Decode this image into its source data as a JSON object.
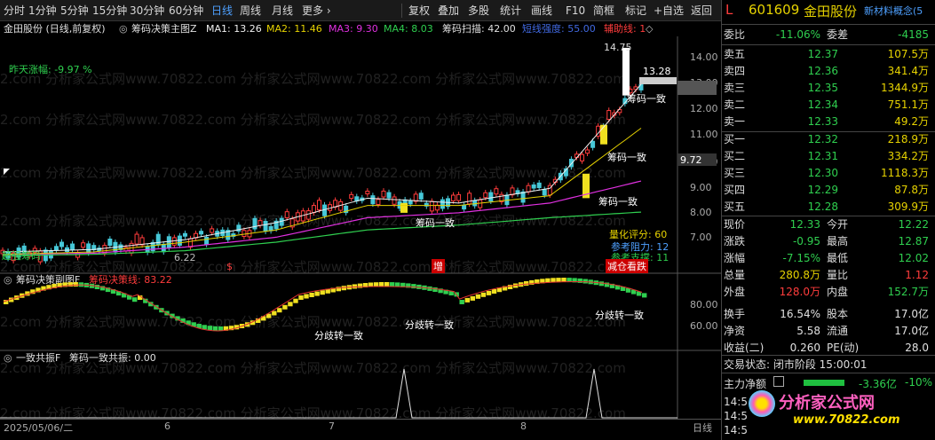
{
  "toolbar": {
    "items": [
      "分时",
      "1分钟",
      "5分钟",
      "15分钟",
      "30分钟",
      "60分钟",
      "日线",
      "周线",
      "月线",
      "更多 ›",
      "复权",
      "叠加",
      "多股",
      "统计",
      "画线",
      "F10",
      "简框",
      "标记",
      "+自选",
      "返回"
    ],
    "active": "日线"
  },
  "main_chart": {
    "title": "金田股份 (日线,前复权)",
    "indicator_name": "筹码决策主图Z",
    "ma1": "MA1: 13.26",
    "ma2": "MA2: 11.46",
    "ma3": "MA3: 9.30",
    "ma4": "MA4: 8.03",
    "scan": "筹码扫描: 42.00",
    "trend": "短线强度: 55.00",
    "aux": "辅助线: 1",
    "yesterday_change": "昨天涨幅: -9.97 %",
    "high_label": "14.75",
    "price_tag": "13.28",
    "cursor_tag": "9.72",
    "low_label": "6.22",
    "score_label": "量化评分: 60",
    "resist_label": "参考阻力: 12",
    "support_label": "参考支撑: 11",
    "signal1": "筹码一致",
    "signal2": "筹码一致",
    "signal3": "筹码一致",
    "signal4": "筹码一致",
    "left_tag": "超强筹码",
    "bottom_tag": "增",
    "red_tag": "$",
    "status_tag": "减仓看跌",
    "y_ticks": [
      "14.00",
      "13.00",
      "12.00",
      "11.00",
      "10.00",
      "9.00",
      "8.00",
      "7.00"
    ]
  },
  "sub_chart1": {
    "name": "筹码决策副图F",
    "value": "筹码决策线: 83.22",
    "label1": "分歧转一致",
    "label2": "分歧转一致",
    "label3": "分歧转一致",
    "y_ticks": [
      "80.00",
      "60.00"
    ]
  },
  "sub_chart2": {
    "name": "一致共振F",
    "value": "筹码一致共振: 0.00"
  },
  "x_axis": {
    "labels": [
      "2025/05/06/二",
      "6",
      "7",
      "8"
    ],
    "period": "日线"
  },
  "watermark": "2.com 分析家公式网www.70822.com 分析家公式网www.70822.com 分析家公式网www.70822.com",
  "quote": {
    "flag": "L",
    "code": "601609",
    "name": "金田股份",
    "concept": "新材料概念(5",
    "weibi_label": "委比",
    "weibi": "-11.06%",
    "weicha_label": "委差",
    "weicha": "-4185",
    "asks": [
      {
        "label": "卖五",
        "price": "12.37",
        "vol": "107.5万"
      },
      {
        "label": "卖四",
        "price": "12.36",
        "vol": "341.4万"
      },
      {
        "label": "卖三",
        "price": "12.35",
        "vol": "1344.9万"
      },
      {
        "label": "卖二",
        "price": "12.34",
        "vol": "751.1万"
      },
      {
        "label": "卖一",
        "price": "12.33",
        "vol": "49.2万"
      }
    ],
    "bids": [
      {
        "label": "买一",
        "price": "12.32",
        "vol": "218.9万"
      },
      {
        "label": "买二",
        "price": "12.31",
        "vol": "334.2万"
      },
      {
        "label": "买三",
        "price": "12.30",
        "vol": "1118.3万"
      },
      {
        "label": "买四",
        "price": "12.29",
        "vol": "87.8万"
      },
      {
        "label": "买五",
        "price": "12.28",
        "vol": "309.9万"
      }
    ],
    "stats": [
      {
        "l1": "现价",
        "v1": "12.33",
        "c1": "green",
        "l2": "今开",
        "v2": "12.22",
        "c2": "green"
      },
      {
        "l1": "涨跌",
        "v1": "-0.95",
        "c1": "green",
        "l2": "最高",
        "v2": "12.87",
        "c2": "green"
      },
      {
        "l1": "涨幅",
        "v1": "-7.15%",
        "c1": "green",
        "l2": "最低",
        "v2": "12.02",
        "c2": "green"
      },
      {
        "l1": "总量",
        "v1": "280.8万",
        "c1": "yellow",
        "l2": "量比",
        "v2": "1.12",
        "c2": "red"
      },
      {
        "l1": "外盘",
        "v1": "128.0万",
        "c1": "red",
        "l2": "内盘",
        "v2": "152.7万",
        "c2": "green"
      },
      {
        "l1": "换手",
        "v1": "16.54%",
        "c1": "white",
        "l2": "股本",
        "v2": "17.0亿",
        "c2": "white"
      },
      {
        "l1": "净资",
        "v1": "5.58",
        "c1": "white",
        "l2": "流通",
        "v2": "17.0亿",
        "c2": "white"
      },
      {
        "l1": "收益(二)",
        "v1": "0.260",
        "c1": "white",
        "l2": "PE(动)",
        "v2": "28.0",
        "c2": "white"
      }
    ],
    "trade_status": "交易状态: 闭市阶段 15:00:01",
    "main_flow_label": "主力净额",
    "main_flow_value": "-3.36亿",
    "main_flow_pct": "-10%",
    "times": [
      "14:5",
      "14:5",
      "14:5"
    ],
    "logo_text": "分析家公式网",
    "logo_url": "www.70822.com"
  },
  "colors": {
    "up": "#ff3c3c",
    "down": "#2fcf4f",
    "up_body": "#e63030",
    "down_body": "#46c8d8",
    "yellow_bar": "#f0e020",
    "accent_blue": "#4169e1"
  },
  "chart_data": {
    "type": "line",
    "title": "",
    "xlabel": "",
    "ylabel": "",
    "ylim": [
      6.0,
      15.0
    ],
    "note_series": "approximate daily close path",
    "x": [
      "2025/05/06",
      "6",
      "7",
      "8"
    ],
    "series": [
      {
        "name": "MA1",
        "values": [
          6.4,
          6.5,
          6.9,
          7.6,
          8.6,
          8.4,
          9.0,
          13.26
        ]
      },
      {
        "name": "MA2",
        "values": [
          6.3,
          6.4,
          6.8,
          7.3,
          8.3,
          8.3,
          8.7,
          11.46
        ]
      },
      {
        "name": "MA3",
        "values": [
          6.3,
          6.35,
          6.6,
          7.0,
          7.8,
          8.0,
          8.4,
          9.3
        ]
      },
      {
        "name": "MA4",
        "values": [
          6.25,
          6.3,
          6.45,
          6.8,
          7.3,
          7.5,
          7.8,
          8.03
        ]
      }
    ]
  }
}
